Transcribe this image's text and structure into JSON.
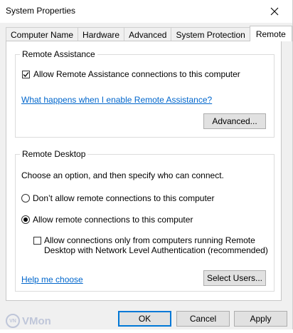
{
  "window": {
    "title": "System Properties"
  },
  "tabs": [
    {
      "label": "Computer Name"
    },
    {
      "label": "Hardware"
    },
    {
      "label": "Advanced"
    },
    {
      "label": "System Protection"
    },
    {
      "label": "Remote",
      "active": true
    }
  ],
  "remote_assistance": {
    "title": "Remote Assistance",
    "allow_label": "Allow Remote Assistance connections to this computer",
    "allow_checked": true,
    "help_link": "What happens when I enable Remote Assistance?",
    "advanced_button": "Advanced..."
  },
  "remote_desktop": {
    "title": "Remote Desktop",
    "instructions": "Choose an option, and then specify who can connect.",
    "option_dont_allow": "Don’t allow remote connections to this computer",
    "option_allow": "Allow remote connections to this computer",
    "selected_option": "allow",
    "nla_label_line1": "Allow connections only from computers running Remote",
    "nla_label_line2": "Desktop with Network Level Authentication (recommended)",
    "nla_checked": false,
    "help_link": "Help me choose",
    "select_users_button": "Select Users..."
  },
  "footer": {
    "ok": "OK",
    "cancel": "Cancel",
    "apply": "Apply"
  },
  "watermark": {
    "text": "VMon",
    "icon_text": "VN"
  },
  "colors": {
    "link": "#0066cc",
    "accent": "#0078d7"
  }
}
